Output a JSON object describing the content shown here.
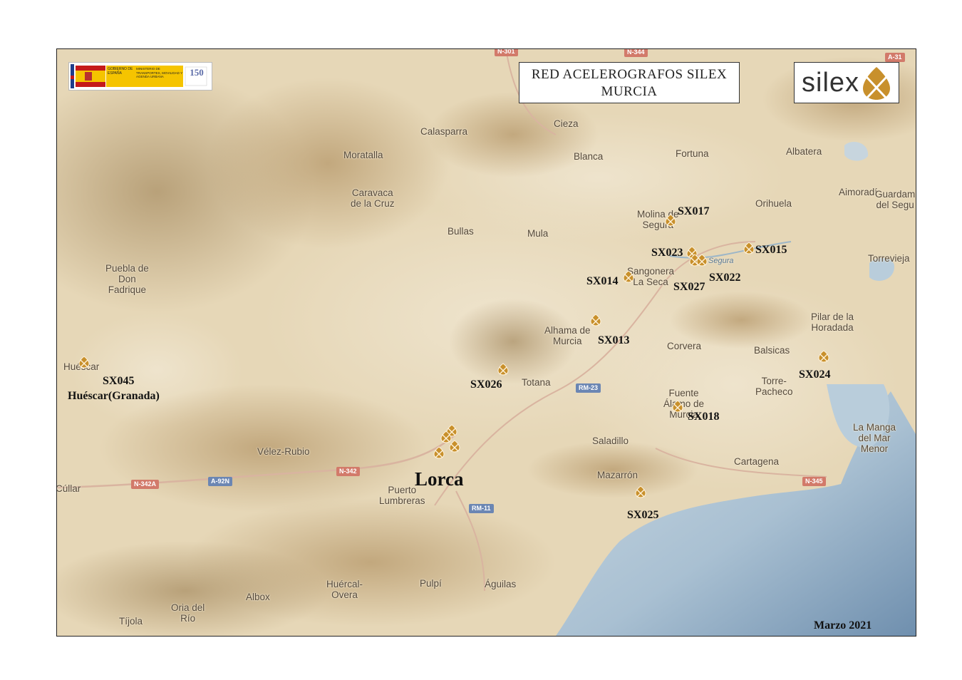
{
  "title": {
    "line1": "RED ACELEROGRAFOS SILEX",
    "line2": "MURCIA"
  },
  "logo": {
    "brand": "silex",
    "color": "#c8902c"
  },
  "ministry_logo": {
    "text1": "GOBIERNO DE ESPAÑA",
    "text2": "MINISTERIO DE TRANSPORTES, MOVILIDAD Y AGENDA URBANA",
    "badge": "150"
  },
  "date": "Marzo 2021",
  "main_city": "Lorca",
  "huescar_station_name": "Huéscar(Granada)",
  "stations": [
    {
      "id": "SX017"
    },
    {
      "id": "SX023"
    },
    {
      "id": "SX015"
    },
    {
      "id": "SX014"
    },
    {
      "id": "SX022"
    },
    {
      "id": "SX027"
    },
    {
      "id": "SX013"
    },
    {
      "id": "SX026"
    },
    {
      "id": "SX024"
    },
    {
      "id": "SX018"
    },
    {
      "id": "SX025"
    },
    {
      "id": "SX045"
    }
  ],
  "places": [
    "Calasparra",
    "Cieza",
    "Moratalla",
    "Blanca",
    "Fortuna",
    "Albatera",
    "Caravaca\nde la Cruz",
    "Aimoradí",
    "Guardam\ndel Segu",
    "Orihuela",
    "Molina de\nSegura",
    "Bullas",
    "Mula",
    "Torrevieja",
    "Puebla de\nDon\nFadrique",
    "Sangonera\nLa Seca",
    "Alhama de\nMurcia",
    "Corvera",
    "Pilar de la\nHoradada",
    "Balsicas",
    "Huéscar",
    "Totana",
    "Torre-\nPacheco",
    "Fuente\nÁlamo de\nMurcia",
    "La Manga\ndel Mar\nMenor",
    "Vélez-Rubio",
    "Saladillo",
    "Cartagena",
    "Cúllar",
    "Puerto\nLumbreras",
    "Mazarrón",
    "Huércal-\nOvera",
    "Pulpí",
    "Águilas",
    "Albox",
    "Oria del\nRío",
    "Tíjola",
    "Segura"
  ],
  "roads": [
    "N-342A",
    "A-92N",
    "N-342",
    "RM-23",
    "RM-11",
    "N-345",
    "A-31",
    "N-344",
    "N-301"
  ],
  "colors": {
    "marker": "#c8902c",
    "sea": "#9cb8cc",
    "land": "#e6d7b7",
    "road_badge": "#d27a6a",
    "road_badge_blue": "#6b86b3"
  }
}
